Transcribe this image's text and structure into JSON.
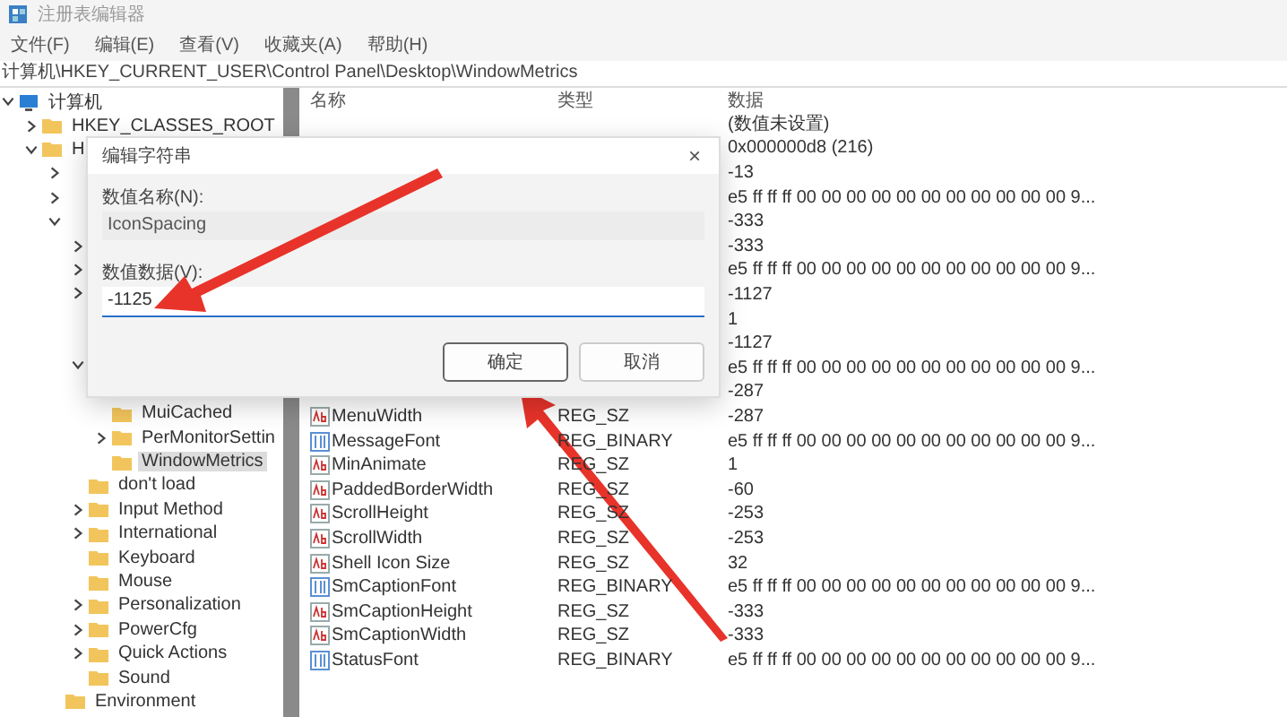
{
  "window": {
    "title": "注册表编辑器"
  },
  "menu": [
    "文件(F)",
    "编辑(E)",
    "查看(V)",
    "收藏夹(A)",
    "帮助(H)"
  ],
  "address": "计算机\\HKEY_CURRENT_USER\\Control Panel\\Desktop\\WindowMetrics",
  "tree": [
    {
      "label": "计算机",
      "kind": "computer",
      "expanded": true,
      "selected": false,
      "children": [
        {
          "label": "HKEY_CLASSES_ROOT",
          "expanded": false,
          "selected": false
        },
        {
          "label": "H",
          "expanded": true,
          "selected": false,
          "children": [
            {
              "expanded": false
            },
            {
              "expanded": false
            },
            {
              "expanded": true,
              "children": [
                {
                  "expanded": false
                },
                {
                  "expanded": false
                },
                {
                  "expanded": false
                },
                {
                  "kind": "covered"
                },
                {
                  "kind": "covered"
                },
                {
                  "expanded": true,
                  "children": [
                    {
                      "kind": "covered"
                    },
                    {
                      "label": "MuiCached",
                      "selected": false
                    },
                    {
                      "label": "PerMonitorSettin",
                      "expanded": false,
                      "selected": false
                    },
                    {
                      "label": "WindowMetrics",
                      "selected": true
                    }
                  ]
                },
                {
                  "label": "don't load",
                  "selected": false
                },
                {
                  "label": "Input Method",
                  "expanded": false,
                  "selected": false
                },
                {
                  "label": "International",
                  "expanded": false,
                  "selected": false
                },
                {
                  "label": "Keyboard",
                  "selected": false
                },
                {
                  "label": "Mouse",
                  "selected": false
                },
                {
                  "label": "Personalization",
                  "expanded": false,
                  "selected": false
                },
                {
                  "label": "PowerCfg",
                  "expanded": false,
                  "selected": false
                },
                {
                  "label": "Quick Actions",
                  "expanded": false,
                  "selected": false
                },
                {
                  "label": "Sound",
                  "selected": false
                }
              ]
            },
            {
              "label": "Environment",
              "selected": false
            }
          ]
        }
      ]
    }
  ],
  "table": {
    "columns": [
      "名称",
      "类型",
      "数据"
    ],
    "rows": [
      {
        "data": "(数值未设置)"
      },
      {
        "data": "0x000000d8 (216)"
      },
      {
        "data": "-13"
      },
      {
        "data": "e5 ff ff ff 00 00 00 00 00 00 00 00 00 00 00 9..."
      },
      {
        "data": "-333"
      },
      {
        "data": "-333"
      },
      {
        "data": "e5 ff ff ff 00 00 00 00 00 00 00 00 00 00 00 9..."
      },
      {
        "data": "-1127"
      },
      {
        "data": "1"
      },
      {
        "data": "-1127"
      },
      {
        "data": "e5 ff ff ff 00 00 00 00 00 00 00 00 00 00 00 9..."
      },
      {
        "data": "-287"
      },
      {
        "name": "MenuWidth",
        "type": "REG_SZ",
        "kind": "string",
        "data": "-287"
      },
      {
        "name": "MessageFont",
        "type": "REG_BINARY",
        "kind": "binary",
        "data": "e5 ff ff ff 00 00 00 00 00 00 00 00 00 00 00 9..."
      },
      {
        "name": "MinAnimate",
        "type": "REG_SZ",
        "kind": "string",
        "data": "1"
      },
      {
        "name": "PaddedBorderWidth",
        "type": "REG_SZ",
        "kind": "string",
        "data": "-60"
      },
      {
        "name": "ScrollHeight",
        "type": "REG_SZ",
        "kind": "string",
        "data": "-253"
      },
      {
        "name": "ScrollWidth",
        "type": "REG_SZ",
        "kind": "string",
        "data": "-253"
      },
      {
        "name": "Shell Icon Size",
        "type": "REG_SZ",
        "kind": "string",
        "data": "32"
      },
      {
        "name": "SmCaptionFont",
        "type": "REG_BINARY",
        "kind": "binary",
        "data": "e5 ff ff ff 00 00 00 00 00 00 00 00 00 00 00 9..."
      },
      {
        "name": "SmCaptionHeight",
        "type": "REG_SZ",
        "kind": "string",
        "data": "-333"
      },
      {
        "name": "SmCaptionWidth",
        "type": "REG_SZ",
        "kind": "string",
        "data": "-333"
      },
      {
        "name": "StatusFont",
        "type": "REG_BINARY",
        "kind": "binary",
        "data": "e5 ff ff ff 00 00 00 00 00 00 00 00 00 00 00 9..."
      }
    ]
  },
  "dialog": {
    "title": "编辑字符串",
    "close": "×",
    "name_label": "数值名称(N):",
    "name_value": "IconSpacing",
    "data_label": "数值数据(V):",
    "data_value": "-1125",
    "buttons": [
      {
        "label": "确定",
        "focused": true
      },
      {
        "label": "取消",
        "focused": false
      }
    ]
  }
}
